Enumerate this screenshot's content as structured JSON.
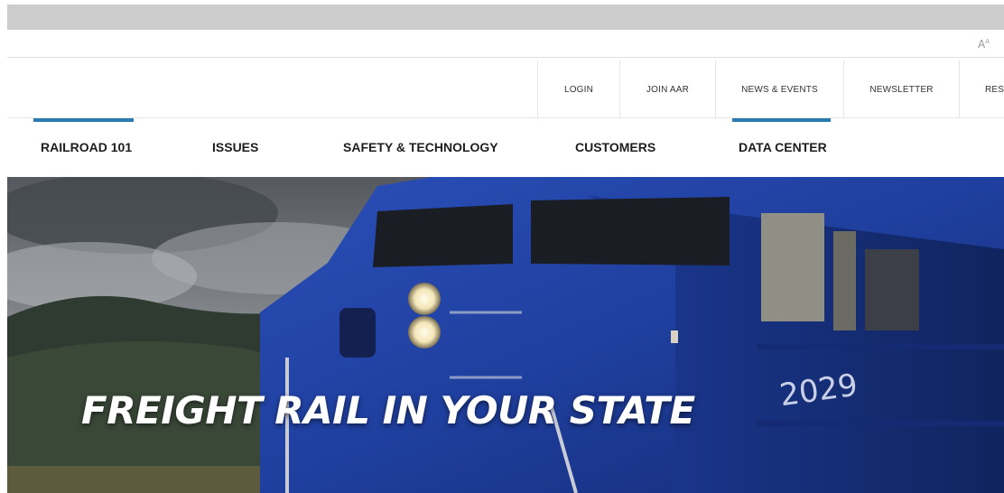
{
  "colors": {
    "accent": "#2a7bb0",
    "locomotive": "#1e3f9a",
    "hero_text": "#ffffff"
  },
  "util_bar": {
    "font_size_icon": "font-size-icon"
  },
  "secondary_nav": {
    "items": [
      {
        "label": "LOGIN"
      },
      {
        "label": "JOIN AAR"
      },
      {
        "label": "NEWS & EVENTS"
      },
      {
        "label": "NEWSLETTER"
      },
      {
        "label": "RESO"
      }
    ],
    "active_label": "NEWS & EVENTS"
  },
  "primary_nav": {
    "items": [
      {
        "label": "RAILROAD 101"
      },
      {
        "label": "ISSUES"
      },
      {
        "label": "SAFETY & TECHNOLOGY"
      },
      {
        "label": "CUSTOMERS"
      },
      {
        "label": "DATA CENTER"
      }
    ],
    "active_label": "RAILROAD 101"
  },
  "hero": {
    "title": "FREIGHT RAIL IN YOUR STATE",
    "locomotive_number": "2029"
  }
}
